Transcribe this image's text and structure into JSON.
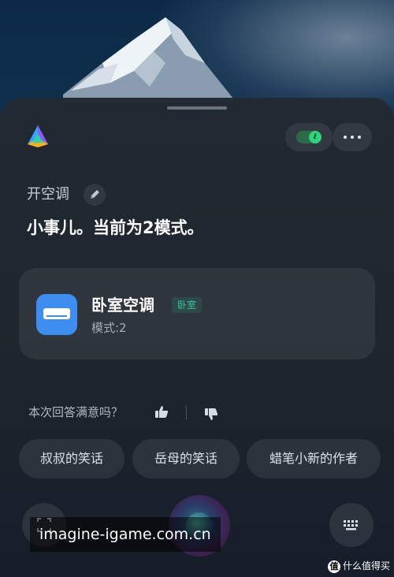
{
  "assistant": {
    "query_text": "开空调",
    "answer_text": "小事儿。当前为2模式。"
  },
  "device_card": {
    "name": "卧室空调",
    "room": "卧室",
    "status": "模式:2",
    "icon": "air-conditioner-icon"
  },
  "header": {
    "logo_icon": "assistant-logo-icon",
    "toggle_glyph": "ℓ",
    "more_icon": "more-dots-icon"
  },
  "feedback": {
    "question": "本次回答满意吗？",
    "like_icon": "thumbs-up-icon",
    "dislike_icon": "thumbs-down-icon"
  },
  "suggestions": [
    {
      "label": "叔叔的笑话"
    },
    {
      "label": "岳母的笑话"
    },
    {
      "label": "蜡笔小新的作者"
    }
  ],
  "bottom_bar": {
    "left_icon": "scan-icon",
    "voice_icon": "voice-orb-icon",
    "right_icon": "keyboard-icon"
  },
  "overlay": {
    "watermark": "imagine-igame.com.cn",
    "corner_mark": "值",
    "corner_text": "什么值得买"
  },
  "colors": {
    "panel": "#22293a",
    "accent_green": "#2fd47a",
    "device_icon_blue": "#3d8ef0",
    "room_badge": "#3fbf96"
  }
}
